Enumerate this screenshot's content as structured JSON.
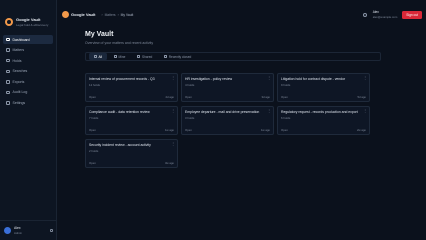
{
  "sidebar": {
    "brand_name": "Google Vault",
    "brand_sub": "Legal hold & eDiscovery",
    "items": [
      {
        "label": "Dashboard",
        "active": true,
        "icon": "grid-icon"
      },
      {
        "label": "Matters",
        "active": false,
        "icon": "folder-icon"
      },
      {
        "label": "Holds",
        "active": false,
        "icon": "lock-icon"
      },
      {
        "label": "Searches",
        "active": false,
        "icon": "search-icon"
      },
      {
        "label": "Exports",
        "active": false,
        "icon": "download-icon"
      },
      {
        "label": "Audit Log",
        "active": false,
        "icon": "list-icon"
      },
      {
        "label": "Settings",
        "active": false,
        "icon": "gear-icon"
      }
    ],
    "user_name": "Alex",
    "user_role": "Admin"
  },
  "topbar": {
    "brand": "Google Vault",
    "crumbs": [
      "Matters",
      "My Vault"
    ],
    "account_name": "Alex",
    "account_sub": "alex@example.com",
    "signout_label": "Sign out"
  },
  "main": {
    "title": "My Vault",
    "subtitle": "Overview of your matters and recent activity",
    "tabs": [
      {
        "label": "All",
        "active": true
      },
      {
        "label": "Mine",
        "active": false
      },
      {
        "label": "Shared",
        "active": false
      },
      {
        "label": "Recently closed",
        "active": false
      }
    ],
    "cards": [
      {
        "title": "Internal review of procurement records - Q3",
        "meta": "12 holds",
        "status": "Open",
        "date": "2d ago"
      },
      {
        "title": "HR investigation - policy review",
        "meta": "4 holds",
        "status": "Open",
        "date": "3d ago"
      },
      {
        "title": "Litigation hold for contract dispute - vendor",
        "meta": "9 holds",
        "status": "Open",
        "date": "5d ago"
      },
      {
        "title": "Compliance audit - data retention review",
        "meta": "7 holds",
        "status": "Open",
        "date": "1w ago"
      },
      {
        "title": "Employee departure - mail and drive preservation",
        "meta": "3 holds",
        "status": "Open",
        "date": "1w ago"
      },
      {
        "title": "Regulatory request - records production and export",
        "meta": "6 holds",
        "status": "Open",
        "date": "2w ago"
      },
      {
        "title": "Security incident review - account activity",
        "meta": "2 holds",
        "status": "Open",
        "date": "3w ago"
      }
    ]
  },
  "colors": {
    "accent": "#d92838",
    "brand": "#f2994a",
    "background": "#0b111c"
  }
}
